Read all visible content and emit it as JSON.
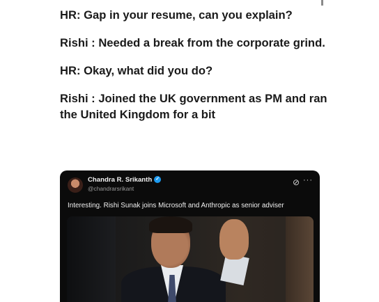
{
  "conversation": [
    {
      "text": "HR: Gap in your resume, can you explain?"
    },
    {
      "text": "Rishi  : Needed a break from the corporate grind."
    },
    {
      "text": "HR: Okay, what did you do?"
    },
    {
      "text": "Rishi : Joined the UK government as PM and ran the United Kingdom for a bit"
    }
  ],
  "embedded_post": {
    "author_name": "Chandra R. Srikanth",
    "handle": "@chandrarsrikant",
    "body": "Interesting. Rishi Sunak joins Microsoft and Anthropic as senior adviser",
    "more_glyph": "···",
    "verified_color": "#1d9bf0"
  },
  "icons": {
    "verified": "verified-badge-icon",
    "grok": "grok-icon",
    "more": "more-options-icon"
  }
}
